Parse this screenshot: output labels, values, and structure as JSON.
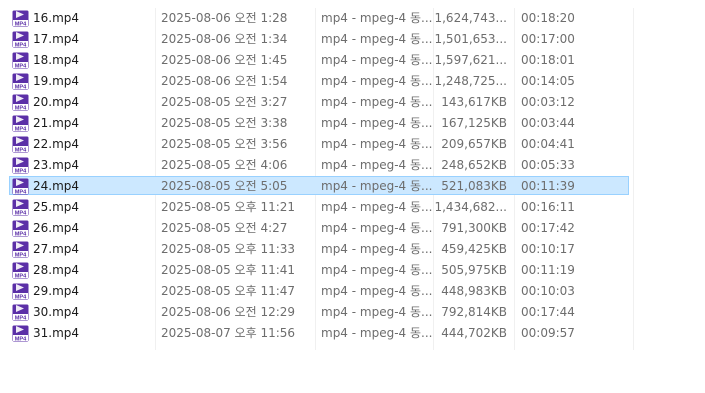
{
  "icon_name": "mp4-file-icon",
  "icon_color": "#5b2fa7",
  "selected_color": "#cce8ff",
  "files": [
    {
      "name": "16.mp4",
      "date": "2025-08-06 오전 1:28",
      "type": "mp4 - mpeg-4 동...",
      "size": "1,624,743...",
      "duration": "00:18:20"
    },
    {
      "name": "17.mp4",
      "date": "2025-08-06 오전 1:34",
      "type": "mp4 - mpeg-4 동...",
      "size": "1,501,653...",
      "duration": "00:17:00"
    },
    {
      "name": "18.mp4",
      "date": "2025-08-06 오전 1:45",
      "type": "mp4 - mpeg-4 동...",
      "size": "1,597,621...",
      "duration": "00:18:01"
    },
    {
      "name": "19.mp4",
      "date": "2025-08-06 오전 1:54",
      "type": "mp4 - mpeg-4 동...",
      "size": "1,248,725...",
      "duration": "00:14:05"
    },
    {
      "name": "20.mp4",
      "date": "2025-08-05 오전 3:27",
      "type": "mp4 - mpeg-4 동...",
      "size": "143,617KB",
      "duration": "00:03:12"
    },
    {
      "name": "21.mp4",
      "date": "2025-08-05 오전 3:38",
      "type": "mp4 - mpeg-4 동...",
      "size": "167,125KB",
      "duration": "00:03:44"
    },
    {
      "name": "22.mp4",
      "date": "2025-08-05 오전 3:56",
      "type": "mp4 - mpeg-4 동...",
      "size": "209,657KB",
      "duration": "00:04:41"
    },
    {
      "name": "23.mp4",
      "date": "2025-08-05 오전 4:06",
      "type": "mp4 - mpeg-4 동...",
      "size": "248,652KB",
      "duration": "00:05:33"
    },
    {
      "name": "24.mp4",
      "date": "2025-08-05 오전 5:05",
      "type": "mp4 - mpeg-4 동...",
      "size": "521,083KB",
      "duration": "00:11:39",
      "selected": true
    },
    {
      "name": "25.mp4",
      "date": "2025-08-05 오후 11:21",
      "type": "mp4 - mpeg-4 동...",
      "size": "1,434,682...",
      "duration": "00:16:11"
    },
    {
      "name": "26.mp4",
      "date": "2025-08-05 오전 4:27",
      "type": "mp4 - mpeg-4 동...",
      "size": "791,300KB",
      "duration": "00:17:42"
    },
    {
      "name": "27.mp4",
      "date": "2025-08-05 오후 11:33",
      "type": "mp4 - mpeg-4 동...",
      "size": "459,425KB",
      "duration": "00:10:17"
    },
    {
      "name": "28.mp4",
      "date": "2025-08-05 오후 11:41",
      "type": "mp4 - mpeg-4 동...",
      "size": "505,975KB",
      "duration": "00:11:19"
    },
    {
      "name": "29.mp4",
      "date": "2025-08-05 오후 11:47",
      "type": "mp4 - mpeg-4 동...",
      "size": "448,983KB",
      "duration": "00:10:03"
    },
    {
      "name": "30.mp4",
      "date": "2025-08-06 오전 12:29",
      "type": "mp4 - mpeg-4 동...",
      "size": "792,814KB",
      "duration": "00:17:44"
    },
    {
      "name": "31.mp4",
      "date": "2025-08-07 오후 11:56",
      "type": "mp4 - mpeg-4 동...",
      "size": "444,702KB",
      "duration": "00:09:57"
    }
  ]
}
